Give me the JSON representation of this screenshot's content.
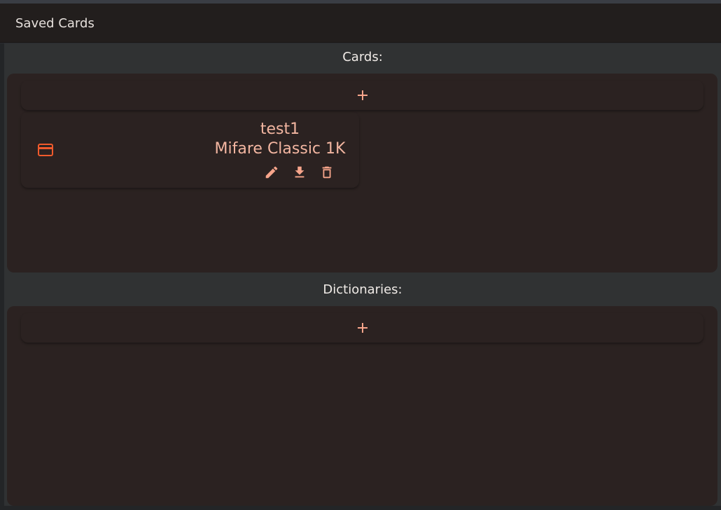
{
  "header": {
    "title": "Saved Cards"
  },
  "cards_section": {
    "title": "Cards:",
    "add_label": "+",
    "items": [
      {
        "name": "test1",
        "type": "Mifare Classic 1K",
        "icon": "credit-card-icon"
      }
    ]
  },
  "dictionaries_section": {
    "title": "Dictionaries:",
    "add_label": "+",
    "items": []
  },
  "colors": {
    "accent": "#f7a58b",
    "card_icon": "#f05a2c",
    "panel_bg": "#2b2221",
    "page_bg": "#303233",
    "header_bg": "#221e1d"
  }
}
